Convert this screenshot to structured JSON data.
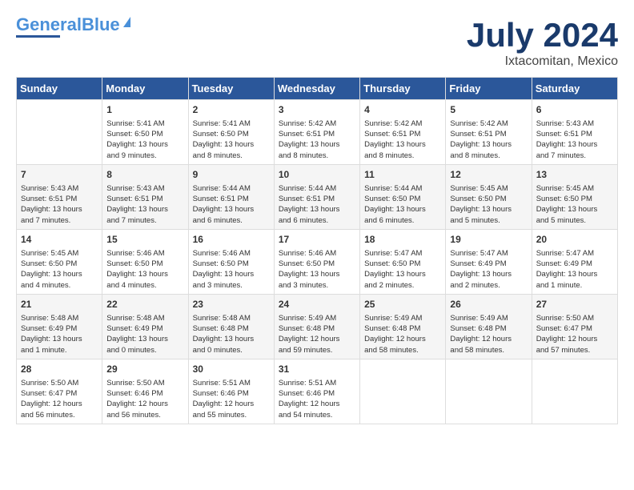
{
  "header": {
    "logo_line1": "General",
    "logo_line2": "Blue",
    "month": "July 2024",
    "location": "Ixtacomitan, Mexico"
  },
  "weekdays": [
    "Sunday",
    "Monday",
    "Tuesday",
    "Wednesday",
    "Thursday",
    "Friday",
    "Saturday"
  ],
  "weeks": [
    [
      {
        "day": "",
        "info": ""
      },
      {
        "day": "1",
        "info": "Sunrise: 5:41 AM\nSunset: 6:50 PM\nDaylight: 13 hours\nand 9 minutes."
      },
      {
        "day": "2",
        "info": "Sunrise: 5:41 AM\nSunset: 6:50 PM\nDaylight: 13 hours\nand 8 minutes."
      },
      {
        "day": "3",
        "info": "Sunrise: 5:42 AM\nSunset: 6:51 PM\nDaylight: 13 hours\nand 8 minutes."
      },
      {
        "day": "4",
        "info": "Sunrise: 5:42 AM\nSunset: 6:51 PM\nDaylight: 13 hours\nand 8 minutes."
      },
      {
        "day": "5",
        "info": "Sunrise: 5:42 AM\nSunset: 6:51 PM\nDaylight: 13 hours\nand 8 minutes."
      },
      {
        "day": "6",
        "info": "Sunrise: 5:43 AM\nSunset: 6:51 PM\nDaylight: 13 hours\nand 7 minutes."
      }
    ],
    [
      {
        "day": "7",
        "info": "Sunrise: 5:43 AM\nSunset: 6:51 PM\nDaylight: 13 hours\nand 7 minutes."
      },
      {
        "day": "8",
        "info": "Sunrise: 5:43 AM\nSunset: 6:51 PM\nDaylight: 13 hours\nand 7 minutes."
      },
      {
        "day": "9",
        "info": "Sunrise: 5:44 AM\nSunset: 6:51 PM\nDaylight: 13 hours\nand 6 minutes."
      },
      {
        "day": "10",
        "info": "Sunrise: 5:44 AM\nSunset: 6:51 PM\nDaylight: 13 hours\nand 6 minutes."
      },
      {
        "day": "11",
        "info": "Sunrise: 5:44 AM\nSunset: 6:50 PM\nDaylight: 13 hours\nand 6 minutes."
      },
      {
        "day": "12",
        "info": "Sunrise: 5:45 AM\nSunset: 6:50 PM\nDaylight: 13 hours\nand 5 minutes."
      },
      {
        "day": "13",
        "info": "Sunrise: 5:45 AM\nSunset: 6:50 PM\nDaylight: 13 hours\nand 5 minutes."
      }
    ],
    [
      {
        "day": "14",
        "info": "Sunrise: 5:45 AM\nSunset: 6:50 PM\nDaylight: 13 hours\nand 4 minutes."
      },
      {
        "day": "15",
        "info": "Sunrise: 5:46 AM\nSunset: 6:50 PM\nDaylight: 13 hours\nand 4 minutes."
      },
      {
        "day": "16",
        "info": "Sunrise: 5:46 AM\nSunset: 6:50 PM\nDaylight: 13 hours\nand 3 minutes."
      },
      {
        "day": "17",
        "info": "Sunrise: 5:46 AM\nSunset: 6:50 PM\nDaylight: 13 hours\nand 3 minutes."
      },
      {
        "day": "18",
        "info": "Sunrise: 5:47 AM\nSunset: 6:50 PM\nDaylight: 13 hours\nand 2 minutes."
      },
      {
        "day": "19",
        "info": "Sunrise: 5:47 AM\nSunset: 6:49 PM\nDaylight: 13 hours\nand 2 minutes."
      },
      {
        "day": "20",
        "info": "Sunrise: 5:47 AM\nSunset: 6:49 PM\nDaylight: 13 hours\nand 1 minute."
      }
    ],
    [
      {
        "day": "21",
        "info": "Sunrise: 5:48 AM\nSunset: 6:49 PM\nDaylight: 13 hours\nand 1 minute."
      },
      {
        "day": "22",
        "info": "Sunrise: 5:48 AM\nSunset: 6:49 PM\nDaylight: 13 hours\nand 0 minutes."
      },
      {
        "day": "23",
        "info": "Sunrise: 5:48 AM\nSunset: 6:48 PM\nDaylight: 13 hours\nand 0 minutes."
      },
      {
        "day": "24",
        "info": "Sunrise: 5:49 AM\nSunset: 6:48 PM\nDaylight: 12 hours\nand 59 minutes."
      },
      {
        "day": "25",
        "info": "Sunrise: 5:49 AM\nSunset: 6:48 PM\nDaylight: 12 hours\nand 58 minutes."
      },
      {
        "day": "26",
        "info": "Sunrise: 5:49 AM\nSunset: 6:48 PM\nDaylight: 12 hours\nand 58 minutes."
      },
      {
        "day": "27",
        "info": "Sunrise: 5:50 AM\nSunset: 6:47 PM\nDaylight: 12 hours\nand 57 minutes."
      }
    ],
    [
      {
        "day": "28",
        "info": "Sunrise: 5:50 AM\nSunset: 6:47 PM\nDaylight: 12 hours\nand 56 minutes."
      },
      {
        "day": "29",
        "info": "Sunrise: 5:50 AM\nSunset: 6:46 PM\nDaylight: 12 hours\nand 56 minutes."
      },
      {
        "day": "30",
        "info": "Sunrise: 5:51 AM\nSunset: 6:46 PM\nDaylight: 12 hours\nand 55 minutes."
      },
      {
        "day": "31",
        "info": "Sunrise: 5:51 AM\nSunset: 6:46 PM\nDaylight: 12 hours\nand 54 minutes."
      },
      {
        "day": "",
        "info": ""
      },
      {
        "day": "",
        "info": ""
      },
      {
        "day": "",
        "info": ""
      }
    ]
  ]
}
